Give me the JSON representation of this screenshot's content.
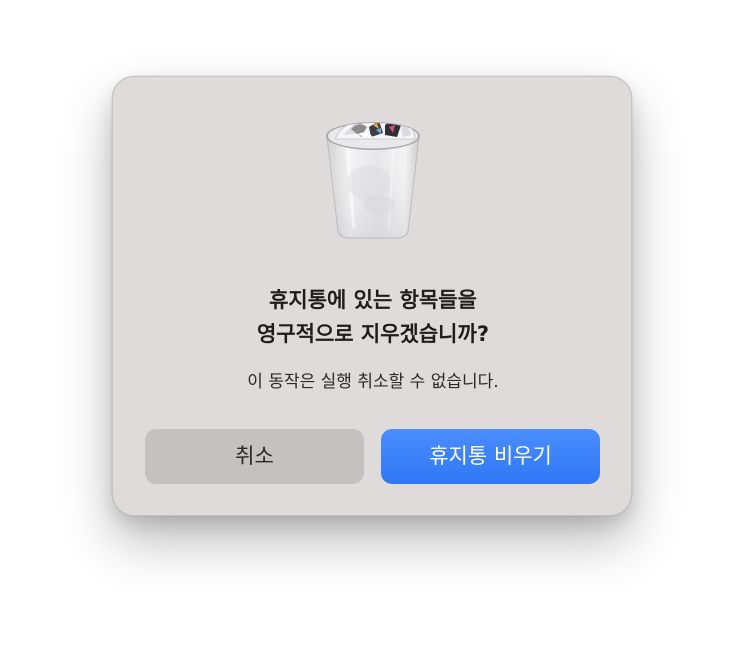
{
  "dialog": {
    "icon": "trash-full-icon",
    "title_line1": "휴지통에 있는 항목들을",
    "title_line2": "영구적으로 지우겠습니까?",
    "message": "이 동작은 실행 취소할 수 없습니다.",
    "cancel_label": "취소",
    "confirm_label": "휴지통 비우기"
  },
  "colors": {
    "dialog_background": "#dfdbdb",
    "cancel_button": "#c5c1c1",
    "confirm_button": "#3a80f9",
    "confirm_text": "#ffffff"
  }
}
